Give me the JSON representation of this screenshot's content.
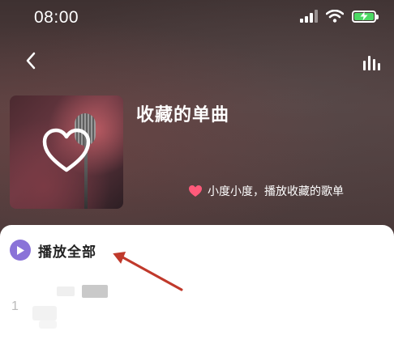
{
  "status_bar": {
    "time": "08:00"
  },
  "playlist": {
    "title": "收藏的单曲",
    "voice_hint": "小度小度，播放收藏的歌单"
  },
  "actions": {
    "play_all_label": "播放全部"
  },
  "songs": [
    {
      "index": "1"
    }
  ],
  "colors": {
    "accent_purple": "#8a73d8",
    "heart_pink": "#ff5a7a",
    "arrow_red": "#c0392b",
    "battery_green": "#4cd964"
  },
  "icons": [
    "back-icon",
    "equalizer-icon",
    "heart-icon",
    "play-icon",
    "wifi-icon",
    "battery-icon",
    "signal-icon"
  ]
}
